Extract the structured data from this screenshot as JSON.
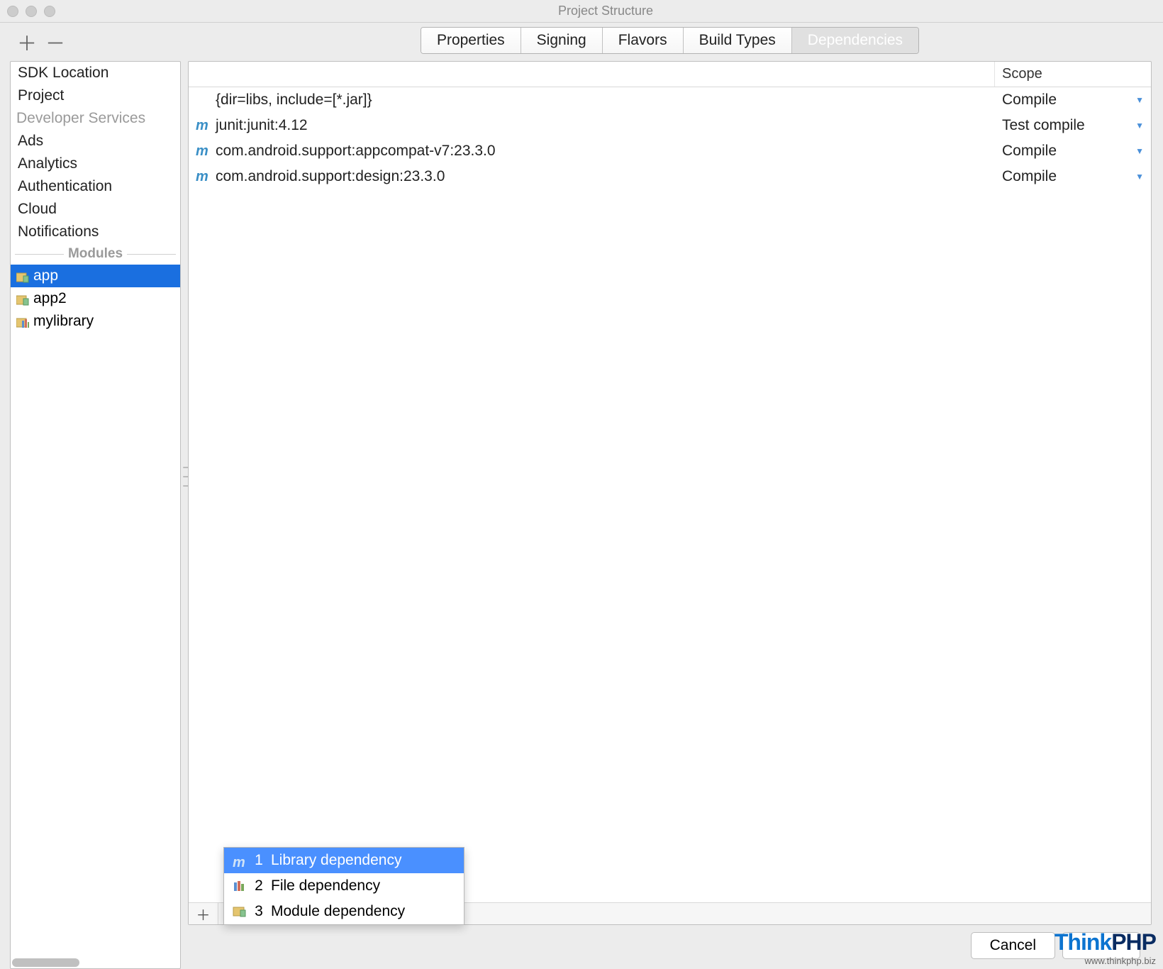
{
  "title": "Project Structure",
  "sidebar": {
    "items": [
      "SDK Location",
      "Project"
    ],
    "section1": "Developer Services",
    "services": [
      "Ads",
      "Analytics",
      "Authentication",
      "Cloud",
      "Notifications"
    ],
    "modules_label": "Modules",
    "modules": [
      "app",
      "app2",
      "mylibrary"
    ],
    "selected_module_index": 0
  },
  "tabs": [
    "Properties",
    "Signing",
    "Flavors",
    "Build Types",
    "Dependencies"
  ],
  "active_tab_index": 4,
  "table": {
    "scope_header": "Scope",
    "rows": [
      {
        "icon": "",
        "name": "{dir=libs, include=[*.jar]}",
        "scope": "Compile"
      },
      {
        "icon": "m",
        "name": "junit:junit:4.12",
        "scope": "Test compile"
      },
      {
        "icon": "m",
        "name": "com.android.support:appcompat-v7:23.3.0",
        "scope": "Compile"
      },
      {
        "icon": "m",
        "name": "com.android.support:design:23.3.0",
        "scope": "Compile"
      }
    ]
  },
  "popup": {
    "items": [
      {
        "num": "1",
        "label": "Library dependency"
      },
      {
        "num": "2",
        "label": "File dependency"
      },
      {
        "num": "3",
        "label": "Module dependency"
      }
    ],
    "selected_index": 0
  },
  "buttons": {
    "cancel": "Cancel"
  },
  "watermark": {
    "brand1": "Think",
    "brand2": "PHP",
    "url": "www.thinkphp.biz"
  }
}
